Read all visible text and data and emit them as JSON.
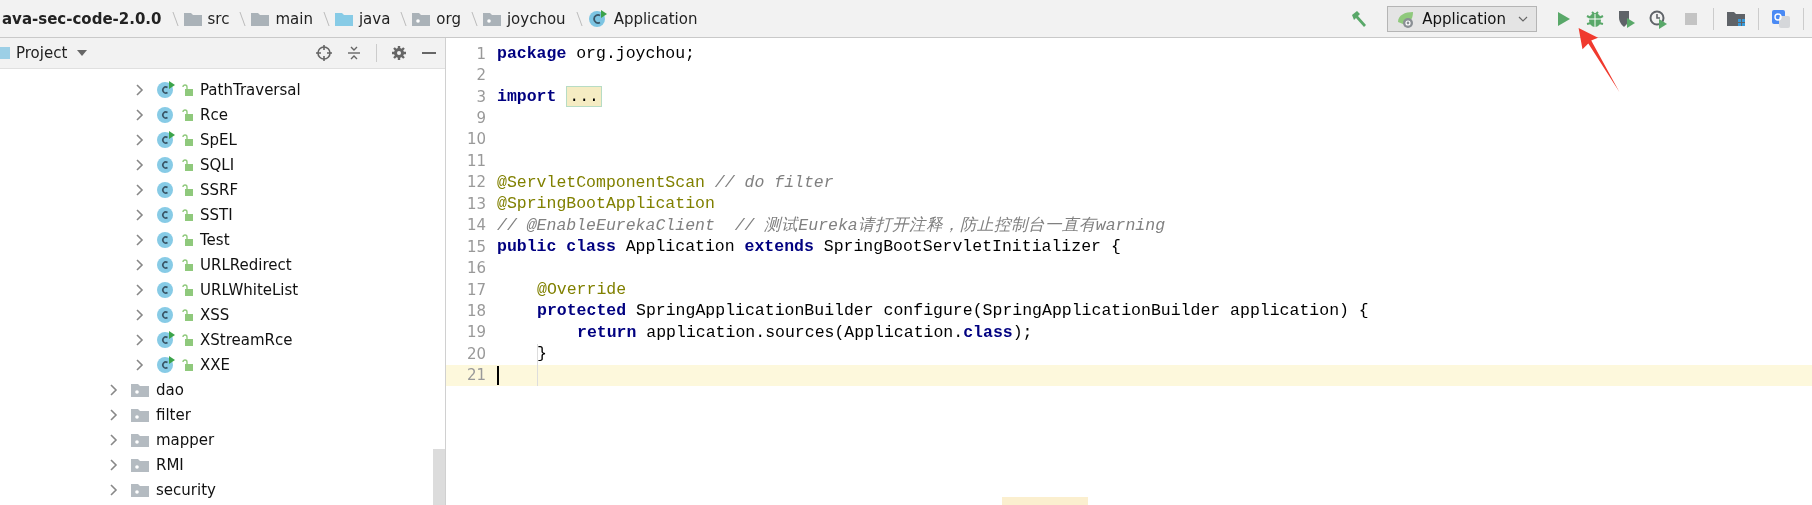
{
  "breadcrumbs": [
    {
      "kind": "project",
      "label": "ava-sec-code-2.0.0"
    },
    {
      "kind": "folder",
      "label": "src"
    },
    {
      "kind": "folder",
      "label": "main"
    },
    {
      "kind": "source",
      "label": "java"
    },
    {
      "kind": "package",
      "label": "org"
    },
    {
      "kind": "package",
      "label": "joychou"
    },
    {
      "kind": "class",
      "label": "Application"
    }
  ],
  "toolbar": {
    "run_config": "Application",
    "stop_disabled": true
  },
  "project_panel": {
    "title": "Project",
    "classes": [
      {
        "label": "PathTraversal",
        "runnable": true
      },
      {
        "label": "Rce",
        "runnable": false
      },
      {
        "label": "SpEL",
        "runnable": true
      },
      {
        "label": "SQLI",
        "runnable": false
      },
      {
        "label": "SSRF",
        "runnable": false
      },
      {
        "label": "SSTI",
        "runnable": false
      },
      {
        "label": "Test",
        "runnable": false
      },
      {
        "label": "URLRedirect",
        "runnable": false
      },
      {
        "label": "URLWhiteList",
        "runnable": false
      },
      {
        "label": "XSS",
        "runnable": false
      },
      {
        "label": "XStreamRce",
        "runnable": true
      },
      {
        "label": "XXE",
        "runnable": true
      }
    ],
    "packages": [
      {
        "label": "dao"
      },
      {
        "label": "filter"
      },
      {
        "label": "mapper"
      },
      {
        "label": "RMI"
      },
      {
        "label": "security"
      }
    ]
  },
  "editor": {
    "lines": [
      {
        "number": "1",
        "kind": "top",
        "current": false,
        "tokens": [
          {
            "kind": "keyword",
            "text": "package"
          },
          {
            "kind": "plain",
            "text": "org.joychou;"
          }
        ]
      },
      {
        "number": "2",
        "kind": "top",
        "current": false
      },
      {
        "number": "3",
        "kind": "top",
        "current": false,
        "tokens": [
          {
            "kind": "keyword",
            "text": "import"
          },
          {
            "kind": "fold",
            "text": "..."
          }
        ]
      },
      {
        "number": "9",
        "kind": "top",
        "current": false
      },
      {
        "number": "10",
        "kind": "top",
        "current": false
      },
      {
        "number": "11",
        "kind": "top",
        "current": false
      },
      {
        "number": "12",
        "kind": "top",
        "current": false,
        "tokens": [
          {
            "kind": "annotation",
            "text": "@ServletComponentScan"
          },
          {
            "kind": "comment",
            "text": "// do filter"
          }
        ]
      },
      {
        "number": "13",
        "kind": "top",
        "current": false,
        "tokens": [
          {
            "kind": "annotation",
            "text": "@SpringBootApplication"
          }
        ]
      },
      {
        "number": "14",
        "kind": "top",
        "current": false,
        "tokens": [
          {
            "kind": "comment",
            "text": "// @EnableEurekaClient  // 测试Eureka请打开注释，防止控制台一直有warning"
          }
        ]
      },
      {
        "number": "15",
        "kind": "top",
        "current": false,
        "tokens": [
          {
            "kind": "keyword",
            "text": "public class"
          },
          {
            "kind": "plain",
            "text": "Application"
          },
          {
            "kind": "keyword",
            "text": "extends"
          },
          {
            "kind": "plain",
            "text": "SpringBootServletInitializer {"
          }
        ]
      },
      {
        "number": "16",
        "kind": "top",
        "current": false
      },
      {
        "number": "17",
        "kind": "member",
        "current": false,
        "tokens": [
          {
            "kind": "annotation",
            "text": "@Override"
          }
        ]
      },
      {
        "number": "18",
        "kind": "member",
        "current": false,
        "tokens": [
          {
            "kind": "keyword",
            "text": "protected"
          },
          {
            "kind": "plain",
            "text": "SpringApplicationBuilder configure(SpringApplicationBuilder application) {"
          }
        ]
      },
      {
        "number": "19",
        "kind": "statement",
        "current": false,
        "tokens": [
          {
            "kind": "keyword",
            "text": "return"
          },
          {
            "kind": "plain",
            "text": "application.sources(Application."
          },
          {
            "kind": "keyword",
            "text": "class"
          },
          {
            "kind": "plain",
            "text": ");"
          }
        ]
      },
      {
        "number": "20",
        "kind": "member",
        "current": false,
        "tokens": [
          {
            "kind": "plain",
            "text": "}"
          }
        ]
      },
      {
        "number": "21",
        "kind": "top",
        "current": true
      }
    ]
  }
}
